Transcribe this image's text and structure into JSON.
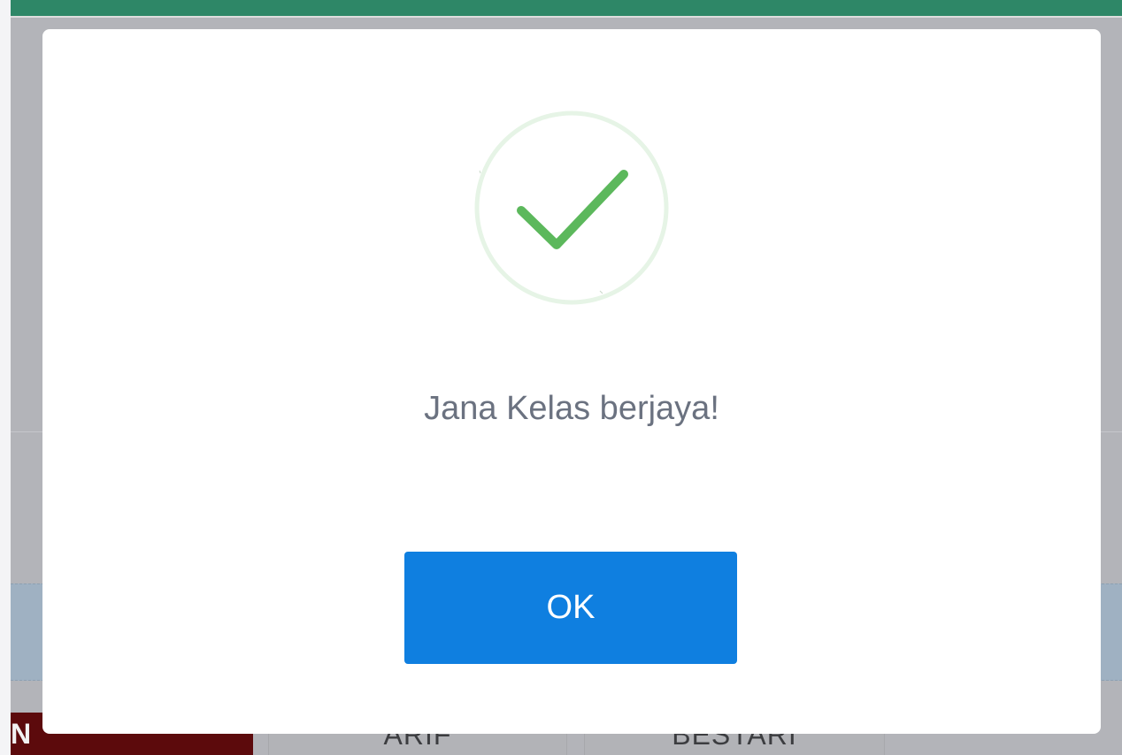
{
  "background": {
    "cells": [
      "N",
      "ARIF",
      "BESTARI"
    ]
  },
  "dialog": {
    "icon": "success-check-icon",
    "message": "Jana Kelas berjaya!",
    "ok_label": "OK"
  },
  "colors": {
    "top_bar": "#2e8767",
    "success_green": "#5cb85c",
    "button_blue": "#0f7fe0",
    "message_gray": "#6b7280"
  }
}
